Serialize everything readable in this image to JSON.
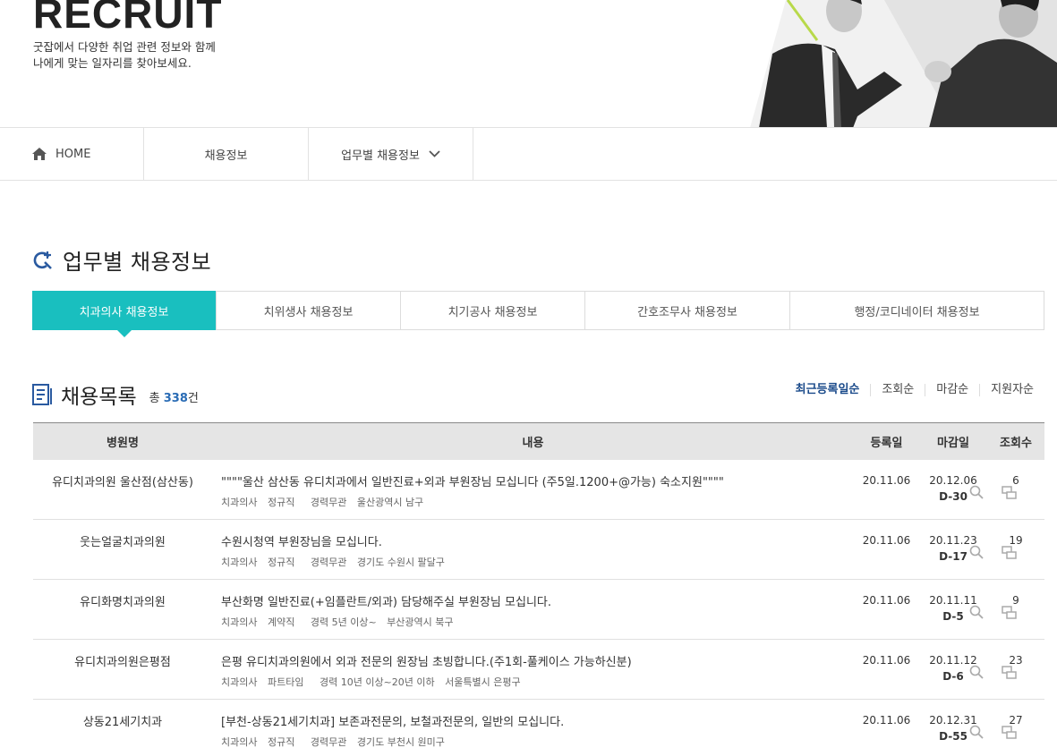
{
  "hero": {
    "title": "RECRUIT",
    "desc_line1": "굿잡에서 다양한 취업 관련 정보와 함께",
    "desc_line2": "나에게 맞는 일자리를 찾아보세요."
  },
  "nav": {
    "home": "HOME",
    "jobs": "채용정보",
    "by_task": "업무별 채용정보"
  },
  "section": {
    "title": "업무별 채용정보"
  },
  "tabs": [
    {
      "label": "치과의사 채용정보"
    },
    {
      "label": "치위생사 채용정보"
    },
    {
      "label": "치기공사 채용정보"
    },
    {
      "label": "간호조무사 채용정보"
    },
    {
      "label": "행정/코디네이터 채용정보"
    }
  ],
  "list": {
    "title": "채용목록",
    "total_prefix": "총",
    "total_count": "338",
    "total_suffix": "건"
  },
  "sort": [
    "최근등록일순",
    "조회순",
    "마감순",
    "지원자순"
  ],
  "columns": {
    "hospital": "병원명",
    "content": "내용",
    "registered": "등록일",
    "deadline": "마감일",
    "views": "조회수"
  },
  "rows": [
    {
      "hospital": "유디치과의원 울산점(삼산동)",
      "subject": "\"\"\"\"울산 삼산동 유디치과에서 일반진료+외과 부원장님 모십니다 (주5일.1200+@가능) 숙소지원\"\"\"\"",
      "job": "치과의사",
      "type": "정규직",
      "career": "경력무관",
      "location": "울산광역시 남구",
      "registered": "20.11.06",
      "deadline": "20.12.06",
      "dday": "D-30",
      "views": "6"
    },
    {
      "hospital": "웃는얼굴치과의원",
      "subject": "수원시청역 부원장님을 모십니다.",
      "job": "치과의사",
      "type": "정규직",
      "career": "경력무관",
      "location": "경기도 수원시 팔달구",
      "registered": "20.11.06",
      "deadline": "20.11.23",
      "dday": "D-17",
      "views": "19"
    },
    {
      "hospital": "유디화명치과의원",
      "subject": "부산화명 일반진료(+임플란트/외과) 담당해주실 부원장님 모십니다.",
      "job": "치과의사",
      "type": "계약직",
      "career": "경력 5년 이상~",
      "location": "부산광역시 북구",
      "registered": "20.11.06",
      "deadline": "20.11.11",
      "dday": "D-5",
      "views": "9"
    },
    {
      "hospital": "유디치과의원은평점",
      "subject": "은평 유디치과의원에서 외과 전문의 원장님 초빙합니다.(주1회-풀케이스 가능하신분)",
      "job": "치과의사",
      "type": "파트타임",
      "career": "경력 10년 이상~20년 이하",
      "location": "서울특별시 은평구",
      "registered": "20.11.06",
      "deadline": "20.11.12",
      "dday": "D-6",
      "views": "23"
    },
    {
      "hospital": "상동21세기치과",
      "subject": "[부천-상동21세기치과] 보존과전문의, 보철과전문의, 일반의 모십니다.",
      "job": "치과의사",
      "type": "정규직",
      "career": "경력무관",
      "location": "경기도 부천시 원미구",
      "registered": "20.11.06",
      "deadline": "20.12.31",
      "dday": "D-55",
      "views": "27"
    }
  ],
  "colors": {
    "accent": "#19bfbf",
    "count": "#2a6cb5",
    "sort_active": "#1a4a8a"
  }
}
